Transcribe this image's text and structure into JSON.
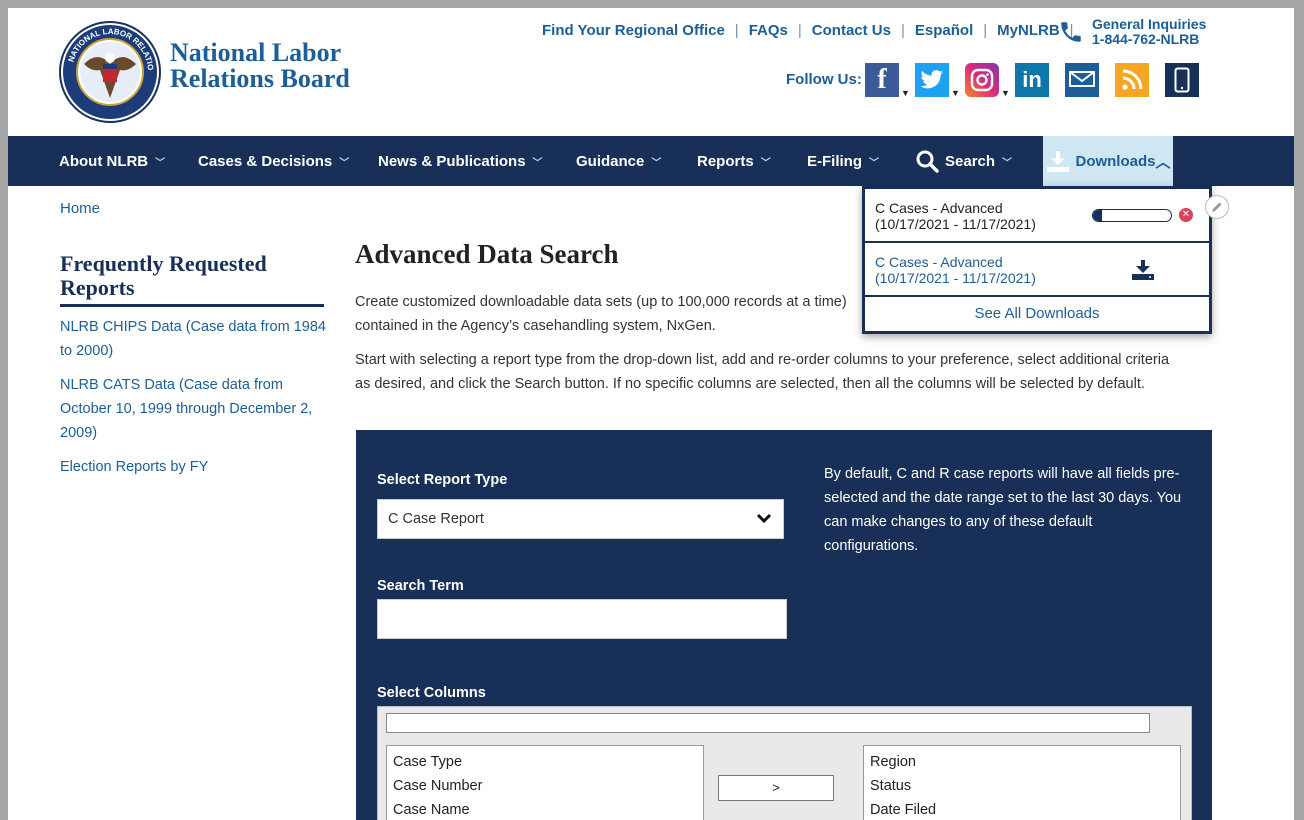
{
  "brand": {
    "line1": "National Labor",
    "line2": "Relations Board"
  },
  "utility_links": [
    "Find Your Regional Office",
    "FAQs",
    "Contact Us",
    "Español",
    "MyNLRB"
  ],
  "inquiries": {
    "label": "General Inquiries",
    "phone": "1-844-762-NLRB"
  },
  "follow_label": "Follow Us:",
  "nav": {
    "items": [
      "About NLRB",
      "Cases & Decisions",
      "News & Publications",
      "Guidance",
      "Reports",
      "E-Filing",
      "Search"
    ],
    "downloads": "Downloads"
  },
  "downloads_panel": {
    "rows": [
      {
        "title": "C Cases - Advanced",
        "range": "(10/17/2021 - 11/17/2021)",
        "status": "in-progress",
        "progress": 0.12
      },
      {
        "title": "C Cases - Advanced",
        "range": "(10/17/2021 - 11/17/2021)",
        "status": "ready"
      }
    ],
    "see_all": "See All Downloads"
  },
  "breadcrumb": "Home",
  "sidebar": {
    "heading_line1": "Frequently Requested",
    "heading_line2": "Reports",
    "links": [
      {
        "lines": [
          "NLRB CHIPS Data  (Case data from 1984",
          "to 2000)"
        ]
      },
      {
        "lines": [
          "NLRB CATS Data  (Case data from",
          "October 10, 1999 through December 2,",
          "2009)"
        ]
      },
      {
        "lines": [
          "Election Reports by FY"
        ]
      }
    ]
  },
  "main": {
    "title": "Advanced Data Search",
    "para1": [
      "Create customized downloadable data sets (up to 100,000 records at a time)",
      "contained in the Agency’s casehandling system, NxGen."
    ],
    "para2": [
      "Start with selecting a report type from the drop-down list, add and re-order columns to your preference, select additional criteria",
      "as desired, and click the Search button. If no specific columns are selected, then all the columns will be selected by default."
    ]
  },
  "form": {
    "report_type_label": "Select Report Type",
    "report_type_value": "C Case Report",
    "search_term_label": "Search Term",
    "search_term_value": "",
    "note_lines": [
      "By default, C and R case reports will have all fields pre-",
      "selected and the date range set to the last 30 days. You",
      "can make changes to any of these default",
      "configurations."
    ],
    "select_columns_label": "Select Columns",
    "available_columns": [
      "Case Type",
      "Case Number",
      "Case Name"
    ],
    "selected_columns": [
      "Region",
      "Status",
      "Date Filed"
    ],
    "move_button": ">"
  },
  "colors": {
    "navy": "#182f57",
    "link": "#1c5e97",
    "downloads_bg": "#cfe6f3",
    "cancel": "#d9435c"
  },
  "icons": [
    "phone-icon",
    "facebook-icon",
    "twitter-icon",
    "instagram-icon",
    "linkedin-icon",
    "email-news-icon",
    "rss-icon",
    "mobile-icon",
    "search-icon",
    "download-icon",
    "cancel-icon",
    "edit-icon",
    "chevron-down-icon"
  ]
}
